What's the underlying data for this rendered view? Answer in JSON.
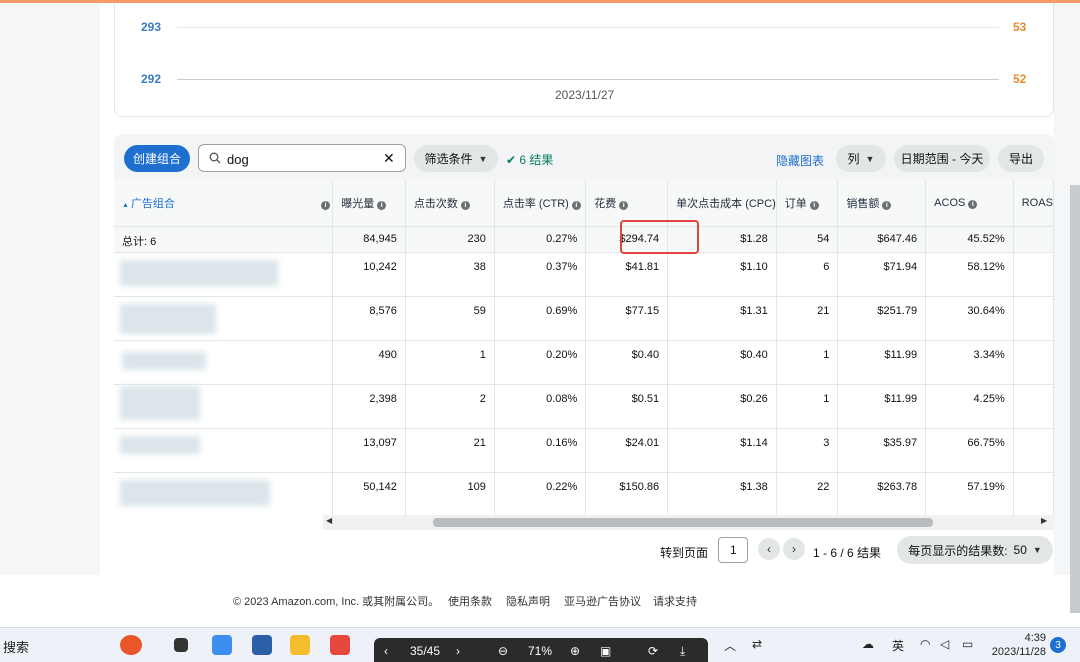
{
  "chart": {
    "left_ticks": [
      "293",
      "292"
    ],
    "right_ticks": [
      "53",
      "52"
    ],
    "x_label": "2023/11/27"
  },
  "toolbar": {
    "create_label": "创建组合",
    "search_value": "dog",
    "filter_label": "筛选条件",
    "result_label": "✔ 6 结果",
    "hide_chart_label": "隐藏图表",
    "columns_label": "列",
    "date_range_label": "日期范围 - 今天",
    "export_label": "导出"
  },
  "table": {
    "headers": {
      "group": "广告组合",
      "impressions": "曝光量",
      "clicks": "点击次数",
      "ctr": "点击率 (CTR)",
      "spend": "花费",
      "cpc": "单次点击成本 (CPC)",
      "orders": "订单",
      "sales": "销售额",
      "acos": "ACOS",
      "roas": "ROAS"
    },
    "total": {
      "label": "总计: 6",
      "impressions": "84,945",
      "clicks": "230",
      "ctr": "0.27%",
      "spend": "$294.74",
      "cpc": "$1.28",
      "orders": "54",
      "sales": "$647.46",
      "acos": "45.52%"
    },
    "rows": [
      {
        "impressions": "10,242",
        "clicks": "38",
        "ctr": "0.37%",
        "spend": "$41.81",
        "cpc": "$1.10",
        "orders": "6",
        "sales": "$71.94",
        "acos": "58.12%"
      },
      {
        "impressions": "8,576",
        "clicks": "59",
        "ctr": "0.69%",
        "spend": "$77.15",
        "cpc": "$1.31",
        "orders": "21",
        "sales": "$251.79",
        "acos": "30.64%"
      },
      {
        "impressions": "490",
        "clicks": "1",
        "ctr": "0.20%",
        "spend": "$0.40",
        "cpc": "$0.40",
        "orders": "1",
        "sales": "$11.99",
        "acos": "3.34%"
      },
      {
        "impressions": "2,398",
        "clicks": "2",
        "ctr": "0.08%",
        "spend": "$0.51",
        "cpc": "$0.26",
        "orders": "1",
        "sales": "$11.99",
        "acos": "4.25%"
      },
      {
        "impressions": "13,097",
        "clicks": "21",
        "ctr": "0.16%",
        "spend": "$24.01",
        "cpc": "$1.14",
        "orders": "3",
        "sales": "$35.97",
        "acos": "66.75%"
      },
      {
        "impressions": "50,142",
        "clicks": "109",
        "ctr": "0.22%",
        "spend": "$150.86",
        "cpc": "$1.38",
        "orders": "22",
        "sales": "$263.78",
        "acos": "57.19%"
      }
    ]
  },
  "pagination": {
    "goto_label": "转到页面",
    "page_value": "1",
    "range_label": "1 - 6 / 6 结果",
    "per_page_label": "每页显示的结果数:",
    "per_page_value": "50"
  },
  "footer": {
    "copyright": "© 2023 Amazon.com, Inc. 或其附属公司。",
    "terms": "使用条款",
    "privacy": "隐私声明",
    "ad_agreement": "亚马逊广告协议",
    "support": "请求支持"
  },
  "taskbar": {
    "search_label": "搜索",
    "viewer_page": "35/45",
    "viewer_zoom": "71%",
    "ime_label": "英",
    "time": "4:39",
    "date": "2023/11/28",
    "notification_count": "3"
  },
  "colors": {
    "accent": "#1f6fd0",
    "highlight": "#e0463c",
    "left_axis": "#3a7cc2",
    "right_axis": "#e88a2e"
  }
}
